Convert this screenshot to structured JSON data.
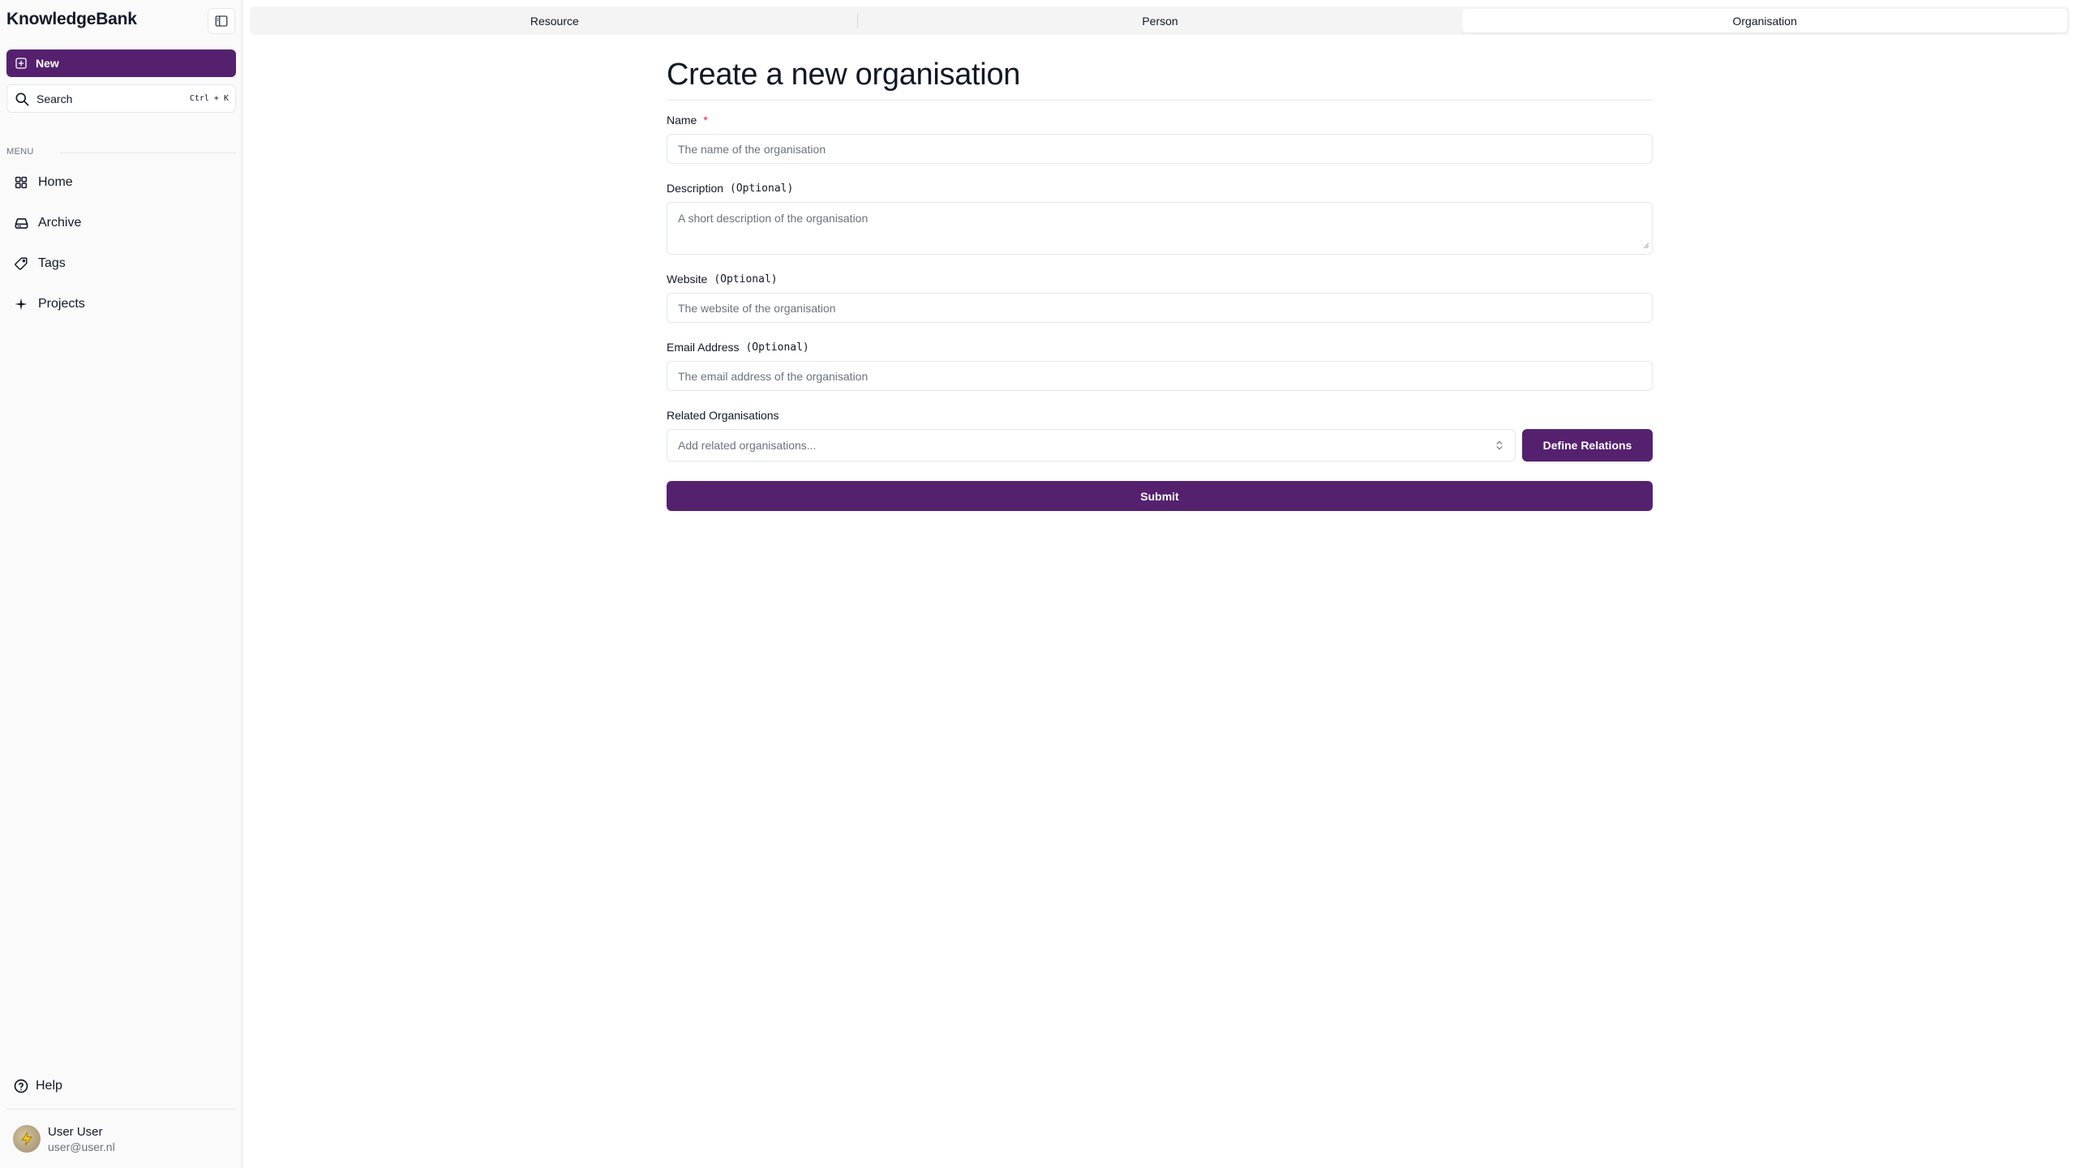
{
  "app": {
    "name": "KnowledgeBank"
  },
  "sidebar": {
    "new_label": "New",
    "search_label": "Search",
    "search_shortcut": "Ctrl + K",
    "menu_label": "MENU",
    "items": [
      {
        "label": "Home",
        "icon": "grid-icon"
      },
      {
        "label": "Archive",
        "icon": "inbox-icon"
      },
      {
        "label": "Tags",
        "icon": "tag-icon"
      },
      {
        "label": "Projects",
        "icon": "sparkle-icon"
      }
    ],
    "help_label": "Help",
    "user": {
      "name": "User User",
      "email": "user@user.nl"
    }
  },
  "tabs": [
    {
      "label": "Resource",
      "active": false
    },
    {
      "label": "Person",
      "active": false
    },
    {
      "label": "Organisation",
      "active": true
    }
  ],
  "form": {
    "title": "Create a new organisation",
    "name": {
      "label": "Name",
      "required_mark": "*",
      "placeholder": "The name of the organisation",
      "value": ""
    },
    "description": {
      "label": "Description",
      "optional": "(Optional)",
      "placeholder": "A short description of the organisation",
      "value": ""
    },
    "website": {
      "label": "Website",
      "optional": "(Optional)",
      "placeholder": "The website of the organisation",
      "value": ""
    },
    "email": {
      "label": "Email Address",
      "optional": "(Optional)",
      "placeholder": "The email address of the organisation",
      "value": ""
    },
    "related": {
      "label": "Related Organisations",
      "placeholder": "Add related organisations...",
      "define_label": "Define Relations"
    },
    "submit_label": "Submit"
  },
  "colors": {
    "accent": "#55216f",
    "required": "#dc2626"
  }
}
